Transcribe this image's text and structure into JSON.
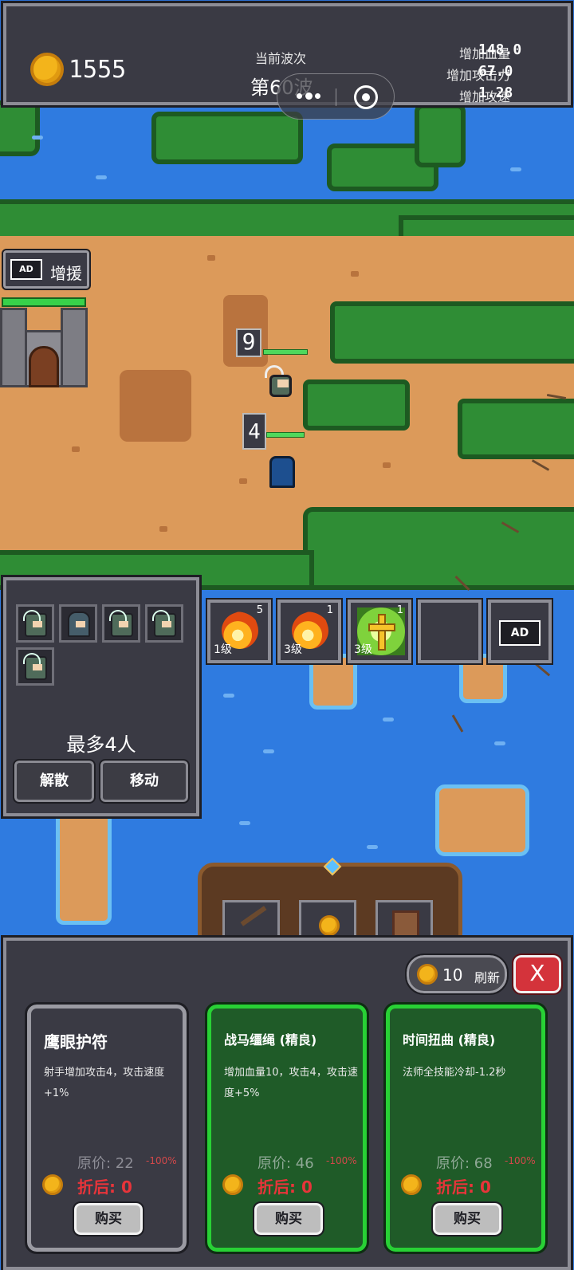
{
  "top_bar": {
    "gold": "1555",
    "wave_label": "当前波次",
    "wave_value": "第60波",
    "stats": [
      {
        "label": "增加血量",
        "value": "148.0"
      },
      {
        "label": "增加攻击力",
        "value": "67.0"
      },
      {
        "label": "增加攻速",
        "value": "1.28"
      }
    ]
  },
  "battlefield": {
    "reinforce": {
      "ad_tag": "AD",
      "label": "增援"
    },
    "castle_hp_fraction": 1.0,
    "units": [
      {
        "badge": "9",
        "hp_fraction": 1.0,
        "type": "archer"
      },
      {
        "badge": "4",
        "hp_fraction": 1.0,
        "type": "mage"
      }
    ]
  },
  "team_panel": {
    "members": [
      "archer",
      "mage",
      "archer",
      "archer",
      "archer"
    ],
    "max_text": "最多4人",
    "disband_label": "解散",
    "move_label": "移动"
  },
  "skills": [
    {
      "icon": "fireball-icon",
      "count": "5",
      "level": "1级"
    },
    {
      "icon": "fireball-icon",
      "count": "1",
      "level": "3级"
    },
    {
      "icon": "holy-cross-icon",
      "count": "1",
      "level": "3级"
    },
    {
      "icon": "",
      "count": "",
      "level": ""
    },
    {
      "icon": "ad-icon",
      "count": "",
      "level": "",
      "ad_tag": "AD"
    }
  ],
  "shop": {
    "refresh_cost": "10",
    "refresh_label": "刷新",
    "close_label": "X",
    "cards": [
      {
        "name": "鹰眼护符",
        "desc": "射手增加攻击4，攻击速度+1%",
        "orig_price": "原价: 22",
        "discount": "-100%",
        "final_price": "折后: 0",
        "buy_label": "购买",
        "rarity": "normal"
      },
      {
        "name": "战马缰绳 (精良)",
        "desc": "增加血量10，攻击4，攻击速度+5%",
        "orig_price": "原价: 46",
        "discount": "-100%",
        "final_price": "折后: 0",
        "buy_label": "购买",
        "rarity": "fine"
      },
      {
        "name": "时间扭曲 (精良)",
        "desc": "法师全技能冷却-1.2秒",
        "orig_price": "原价: 68",
        "discount": "-100%",
        "final_price": "折后: 0",
        "buy_label": "购买",
        "rarity": "fine"
      }
    ]
  },
  "colors": {
    "fine_border": "#28d135",
    "price_red": "#e8343a",
    "close_red": "#d4333b"
  }
}
